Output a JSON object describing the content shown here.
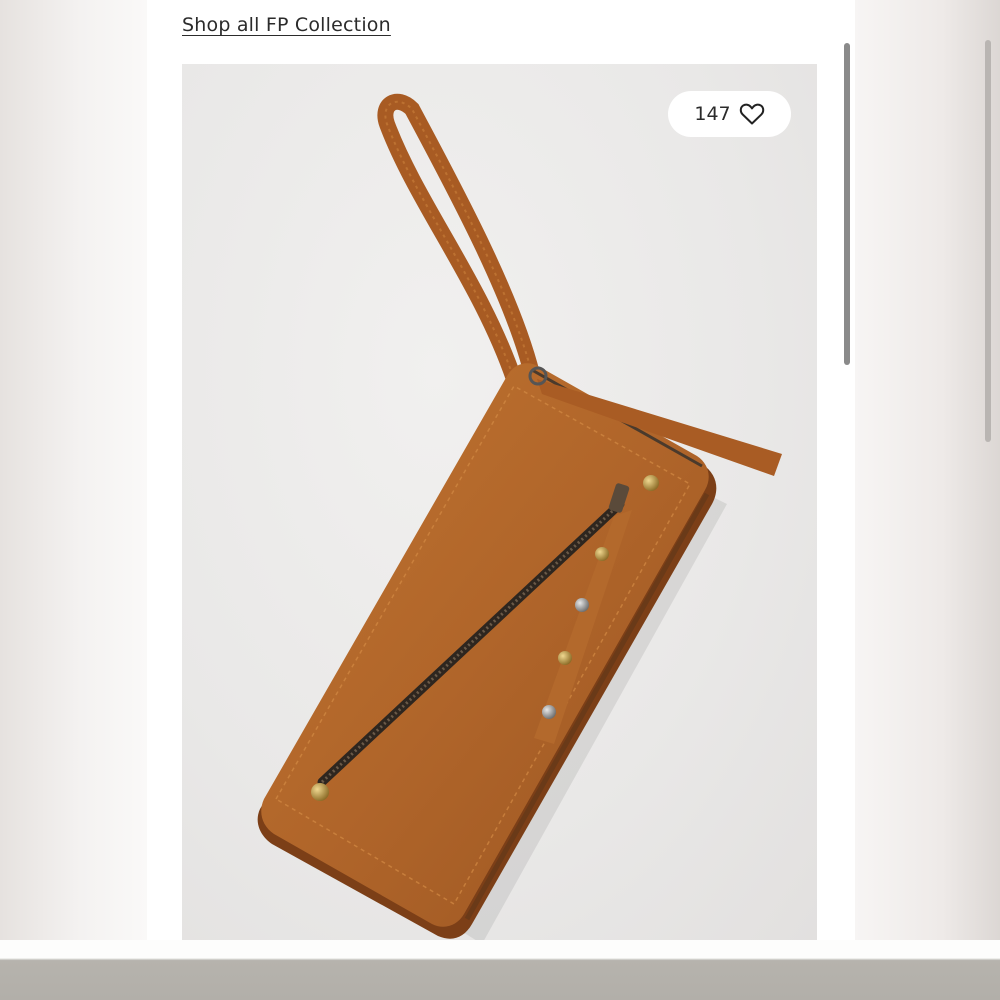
{
  "page": {
    "shop_link": "Shop all FP Collection"
  },
  "product": {
    "image_alt": "Brown faux leather zip wristlet wallet with studded zipper pull",
    "like_count": "147",
    "like_icon": "heart-outline-icon"
  },
  "colors": {
    "leather": "#b0652a",
    "leather_dark": "#8e4b1c",
    "zipper": "#3a3028",
    "stud_brass": "#b8963e",
    "background": "#e9e8e7"
  }
}
